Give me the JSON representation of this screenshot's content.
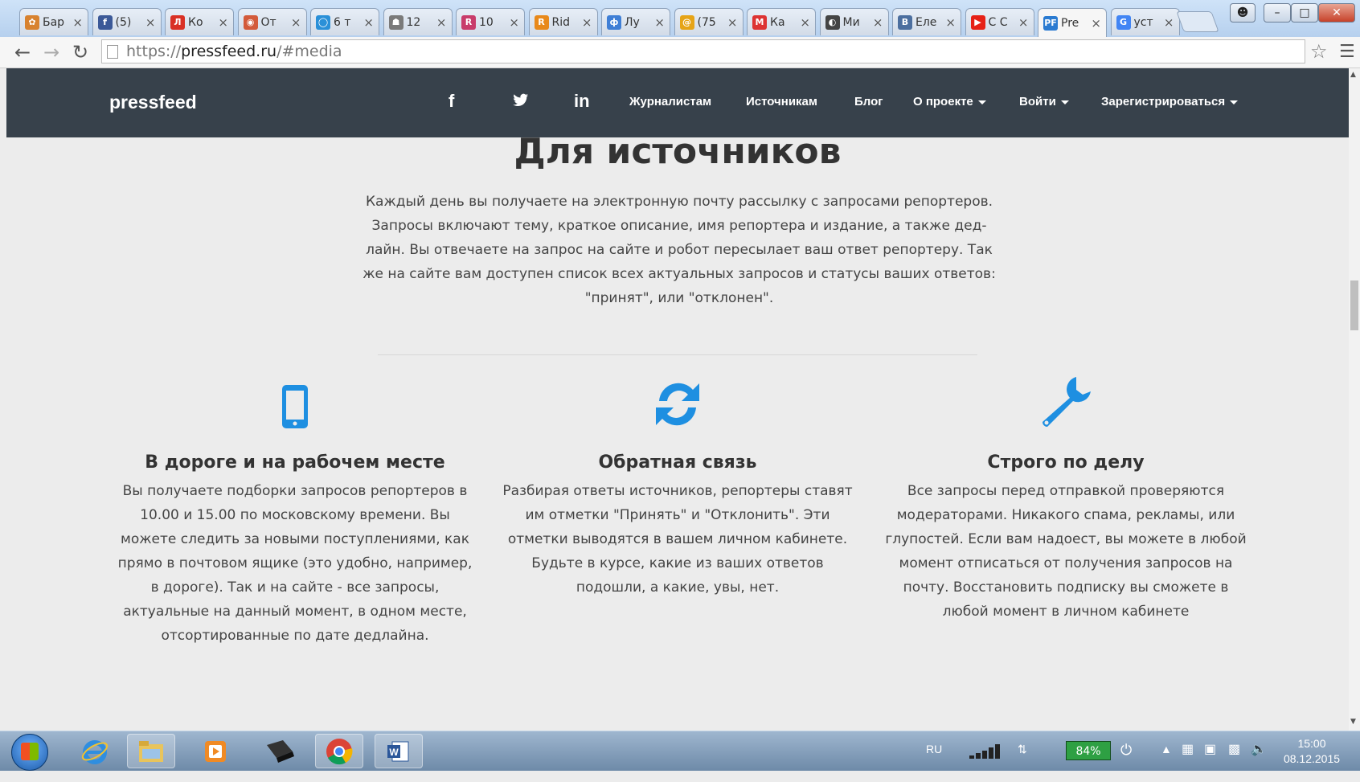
{
  "browser": {
    "tabs": [
      {
        "title": "Бар",
        "fav_color": "#d8822f",
        "fav_glyph": "✿"
      },
      {
        "title": "(5)",
        "fav_color": "#3b5998",
        "fav_glyph": "f"
      },
      {
        "title": "Ко",
        "fav_color": "#d93025",
        "fav_glyph": "Л"
      },
      {
        "title": "От",
        "fav_color": "#d35a3a",
        "fav_glyph": "◉"
      },
      {
        "title": "6 т",
        "fav_color": "#2a90d8",
        "fav_glyph": "◯"
      },
      {
        "title": "12",
        "fav_color": "#7a7a7a",
        "fav_glyph": "☗"
      },
      {
        "title": "10",
        "fav_color": "#c83c6b",
        "fav_glyph": "R"
      },
      {
        "title": "Rid",
        "fav_color": "#e8891b",
        "fav_glyph": "R"
      },
      {
        "title": "Лу",
        "fav_color": "#3f7fd6",
        "fav_glyph": "ф"
      },
      {
        "title": "(75",
        "fav_color": "#e6a417",
        "fav_glyph": "@"
      },
      {
        "title": "Ка",
        "fav_color": "#d33",
        "fav_glyph": "М"
      },
      {
        "title": "Ми",
        "fav_color": "#444",
        "fav_glyph": "◐"
      },
      {
        "title": "Еле",
        "fav_color": "#4c6f9f",
        "fav_glyph": "B"
      },
      {
        "title": "С С",
        "fav_color": "#e62117",
        "fav_glyph": "▶"
      },
      {
        "title": "Pre",
        "fav_color": "#2b7bd1",
        "fav_glyph": "PF"
      },
      {
        "title": "уст",
        "fav_color": "#4285f4",
        "fav_glyph": "G"
      }
    ],
    "active_tab_index": 14,
    "url_scheme": "https://",
    "url_host": "pressfeed.ru",
    "url_path": "/#media"
  },
  "site": {
    "logo": "pressfeed",
    "social": {
      "facebook": "f",
      "twitter": "✦",
      "linkedin": "in"
    },
    "nav": {
      "journalists": "Журналистам",
      "sources": "Источникам",
      "blog": "Блог",
      "about": "О проекте",
      "login": "Войти",
      "register": "Зарегистрироваться"
    }
  },
  "content": {
    "heading": "Для источников",
    "lead": "Каждый день вы получаете на электронную почту рассылку с запросами репортеров. Запросы включают тему, краткое описание, имя репортера и издание, а также дед-лайн. Вы отвечаете на запрос на сайте и робот пересылает ваш ответ репортеру. Так же на сайте вам доступен список всех актуальных запросов и статусы ваших ответов: \"принят\", или \"отклонен\".",
    "features": [
      {
        "icon": "mobile-phone-icon",
        "title": "В дороге и на рабочем месте",
        "text": "Вы получаете подборки запросов репортеров в 10.00 и 15.00 по московскому времени. Вы можете следить за новыми поступлениями, как прямо в почтовом ящике (это удобно, например, в дороге). Так и на сайте - все запросы, актуальные на данный момент, в одном месте, отсортированные по дате дедлайна."
      },
      {
        "icon": "refresh-icon",
        "title": "Обратная связь",
        "text": "Разбирая ответы источников, репортеры ставят им отметки \"Принять\" и \"Отклонить\". Эти отметки выводятся в вашем личном кабинете. Будьте в курсе, какие из ваших ответов подошли, а какие, увы, нет."
      },
      {
        "icon": "wrench-icon",
        "title": "Строго по делу",
        "text": "Все запросы перед отправкой проверяются модераторами. Никакого спама, рекламы, или глупостей. Если вам надоест, вы можете в любой момент отписаться от получения запросов на почту. Восстановить подписку вы сможете в любой момент в личном кабинете"
      }
    ],
    "accent_color": "#1e8fe1",
    "nav_bg": "#37414b"
  },
  "taskbar": {
    "language": "RU",
    "battery": "84%",
    "time": "15:00",
    "date": "08.12.2015"
  }
}
